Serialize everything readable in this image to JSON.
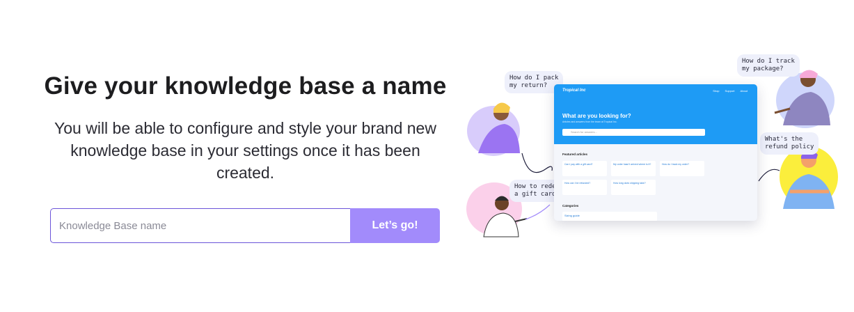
{
  "heading": "Give your knowledge base a name",
  "description": "You will be able to configure and style your brand new knowledge base in your settings once it has been created.",
  "form": {
    "input_value": "",
    "input_placeholder": "Knowledge Base name",
    "submit_label": "Let’s go!"
  },
  "colors": {
    "accent": "#a28bfb",
    "input_border": "#6b54d9",
    "illustration_blue": "#1e9bf5"
  },
  "illustration": {
    "bubbles": [
      "How do I pack\nmy return?",
      "How do I track\nmy package?",
      "What's the\nrefund policy",
      "How to redeem\na gift card?"
    ],
    "preview": {
      "logo": "Tropical Inc",
      "nav": [
        "Shop",
        "Support",
        "About"
      ],
      "hero_title": "What are you looking for?",
      "hero_subtitle": "Articles and answers from the team at Tropical Inc.",
      "search_placeholder": "Search for answers...",
      "featured_heading": "Featured articles",
      "cards": [
        "Can I pay with a gift card?",
        "My order hasn't arrived where is it?",
        "How do I track my order?",
        "How can I be refunded?",
        "How long does shipping take?"
      ],
      "categories_heading": "Categories",
      "category_item": "Sizing guide"
    }
  }
}
